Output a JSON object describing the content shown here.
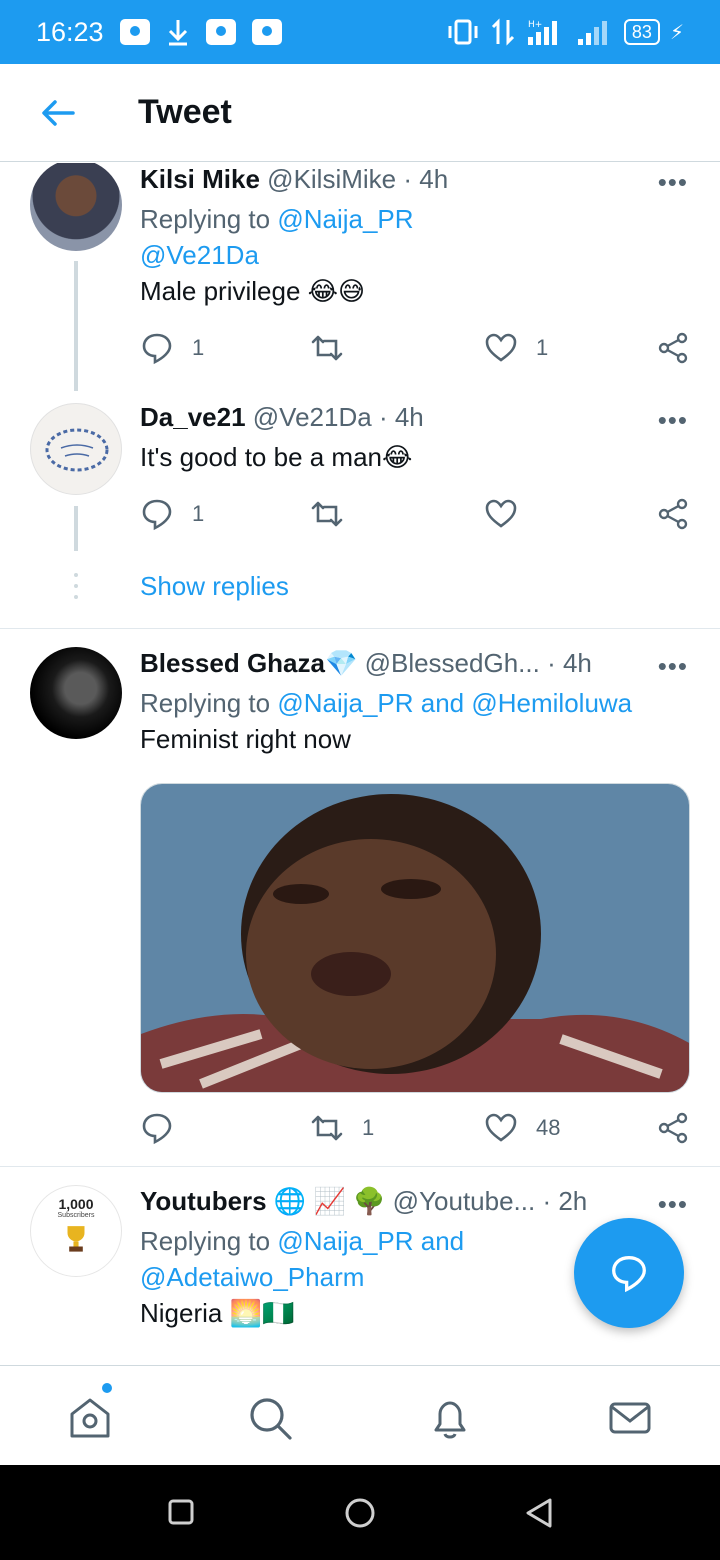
{
  "status_bar": {
    "time": "16:23",
    "battery": "83"
  },
  "header": {
    "title": "Tweet"
  },
  "tweets": [
    {
      "name": "Kilsi Mike",
      "handle": "@KilsiMike",
      "time": "4h",
      "reply_prefix": "Replying to",
      "reply_to": "@Naija_PR",
      "mention": "@Ve21Da",
      "text": "Male privilege 😂😅",
      "replies": "1",
      "retweets": "",
      "likes": "1"
    },
    {
      "name": "Da_ve21",
      "handle": "@Ve21Da",
      "time": "4h",
      "text": "It's good to be a man😂",
      "replies": "1",
      "retweets": "",
      "likes": ""
    },
    {
      "name": "Blessed Ghaza💎",
      "handle": "@BlessedGh...",
      "time": "4h",
      "reply_prefix": "Replying to",
      "reply_to": "@Naija_PR and @Hemiloluwa",
      "text": "Feminist right now",
      "replies": "",
      "retweets": "1",
      "likes": "48"
    },
    {
      "name": "Youtubers 🌐 📈 🌳",
      "handle": "@Youtube...",
      "time": "2h",
      "reply_prefix": "Replying to",
      "reply_to": "@Naija_PR and",
      "reply_to_2": "@Adetaiwo_Pharm",
      "text": "Nigeria 🌅🇳🇬",
      "avatar_text": "1,000",
      "avatar_sub": "Subscribers"
    }
  ],
  "show_replies": "Show replies",
  "colors": {
    "accent": "#1d9bf0",
    "muted": "#536471",
    "text": "#0f1419"
  }
}
